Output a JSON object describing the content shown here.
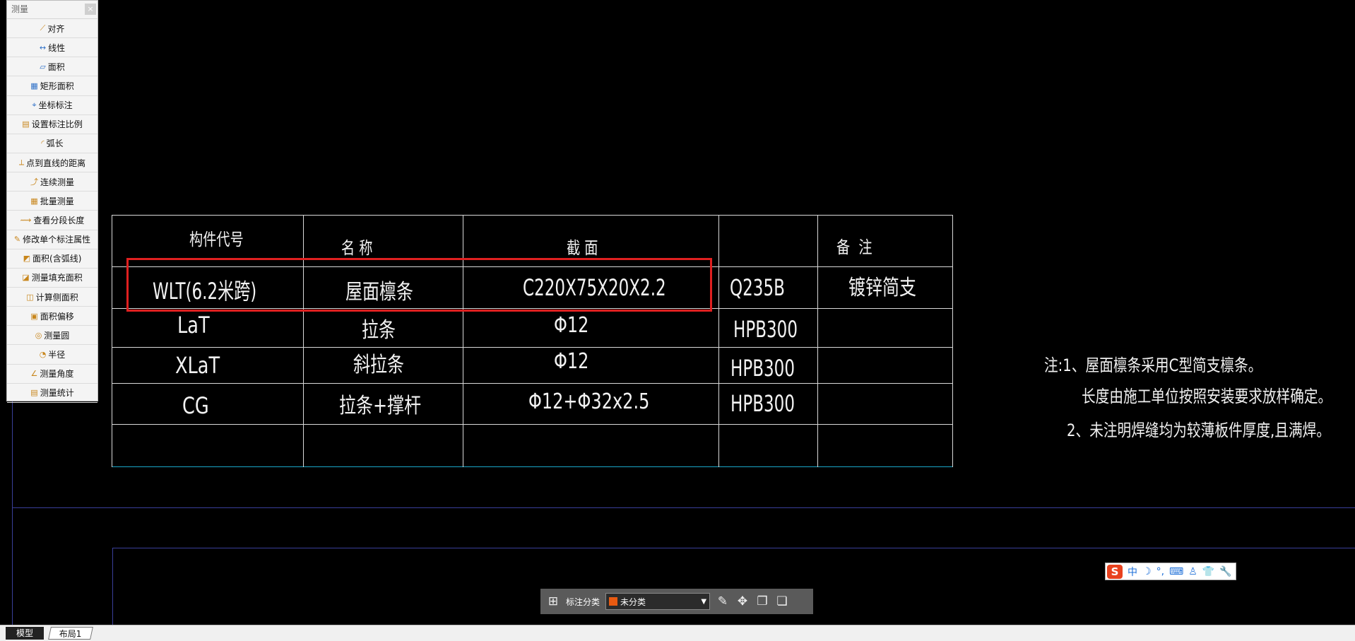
{
  "palette": {
    "title": "测量",
    "close": "×",
    "items": [
      {
        "label": "对齐",
        "icon": "align-measure-icon",
        "glyph": "⟋"
      },
      {
        "label": "线性",
        "icon": "linear-measure-icon",
        "glyph": "↔"
      },
      {
        "label": "面积",
        "icon": "area-icon",
        "glyph": "▱"
      },
      {
        "label": "矩形面积",
        "icon": "rect-area-icon",
        "glyph": "▦"
      },
      {
        "label": "坐标标注",
        "icon": "coordinate-icon",
        "glyph": "⌖"
      },
      {
        "label": "设置标注比例",
        "icon": "scale-icon",
        "glyph": "▤"
      },
      {
        "label": "弧长",
        "icon": "arc-length-icon",
        "glyph": "◜"
      },
      {
        "label": "点到直线的距离",
        "icon": "point-line-icon",
        "glyph": "⟂"
      },
      {
        "label": "连续测量",
        "icon": "continuous-icon",
        "glyph": "⤴"
      },
      {
        "label": "批量测量",
        "icon": "batch-icon",
        "glyph": "▦"
      },
      {
        "label": "查看分段长度",
        "icon": "segment-length-icon",
        "glyph": "⟿"
      },
      {
        "label": "修改单个标注属性",
        "icon": "edit-annotation-icon",
        "glyph": "✎"
      },
      {
        "label": "面积(含弧线)",
        "icon": "arc-area-icon",
        "glyph": "◩"
      },
      {
        "label": "测量填充面积",
        "icon": "fill-area-icon",
        "glyph": "◪"
      },
      {
        "label": "计算侧面积",
        "icon": "side-area-icon",
        "glyph": "◫"
      },
      {
        "label": "面积偏移",
        "icon": "area-offset-icon",
        "glyph": "▣"
      },
      {
        "label": "测量圆",
        "icon": "circle-icon",
        "glyph": "◎"
      },
      {
        "label": "半径",
        "icon": "radius-icon",
        "glyph": "◔"
      },
      {
        "label": "测量角度",
        "icon": "angle-icon",
        "glyph": "∠"
      },
      {
        "label": "测量统计",
        "icon": "statistics-icon",
        "glyph": "▤"
      }
    ]
  },
  "table": {
    "headers": [
      "构件代号",
      "名 称",
      "截 面",
      "",
      "备  注"
    ],
    "rows": [
      [
        "WLT(6.2米跨)",
        "屋面檩条",
        "C220X75X20X2.2",
        "Q235B",
        "镀锌简支"
      ],
      [
        "LaT",
        "拉条",
        "Φ12",
        "HPB300",
        ""
      ],
      [
        "XLaT",
        "斜拉条",
        "Φ12",
        "HPB300",
        ""
      ],
      [
        "CG",
        "拉条+撑杆",
        "Φ12+Φ32x2.5",
        "HPB300",
        ""
      ],
      [
        "",
        "",
        "",
        "",
        ""
      ]
    ]
  },
  "notes": [
    "注:1、屋面檩条采用C型简支檩条。",
    "长度由施工单位按照安装要求放样确定。",
    "2、未注明焊缝均为较薄板件厚度,且满焊。"
  ],
  "ime": {
    "logo": "S",
    "lang": "中",
    "items": [
      "☽",
      "°,",
      "⌨",
      "♙",
      "👕",
      "🔧"
    ]
  },
  "annot_toolbar": {
    "label": "标注分类",
    "selected": "未分类",
    "swatch": "#e85a11"
  },
  "tabs": {
    "model": "模型",
    "layout": "布局1"
  }
}
